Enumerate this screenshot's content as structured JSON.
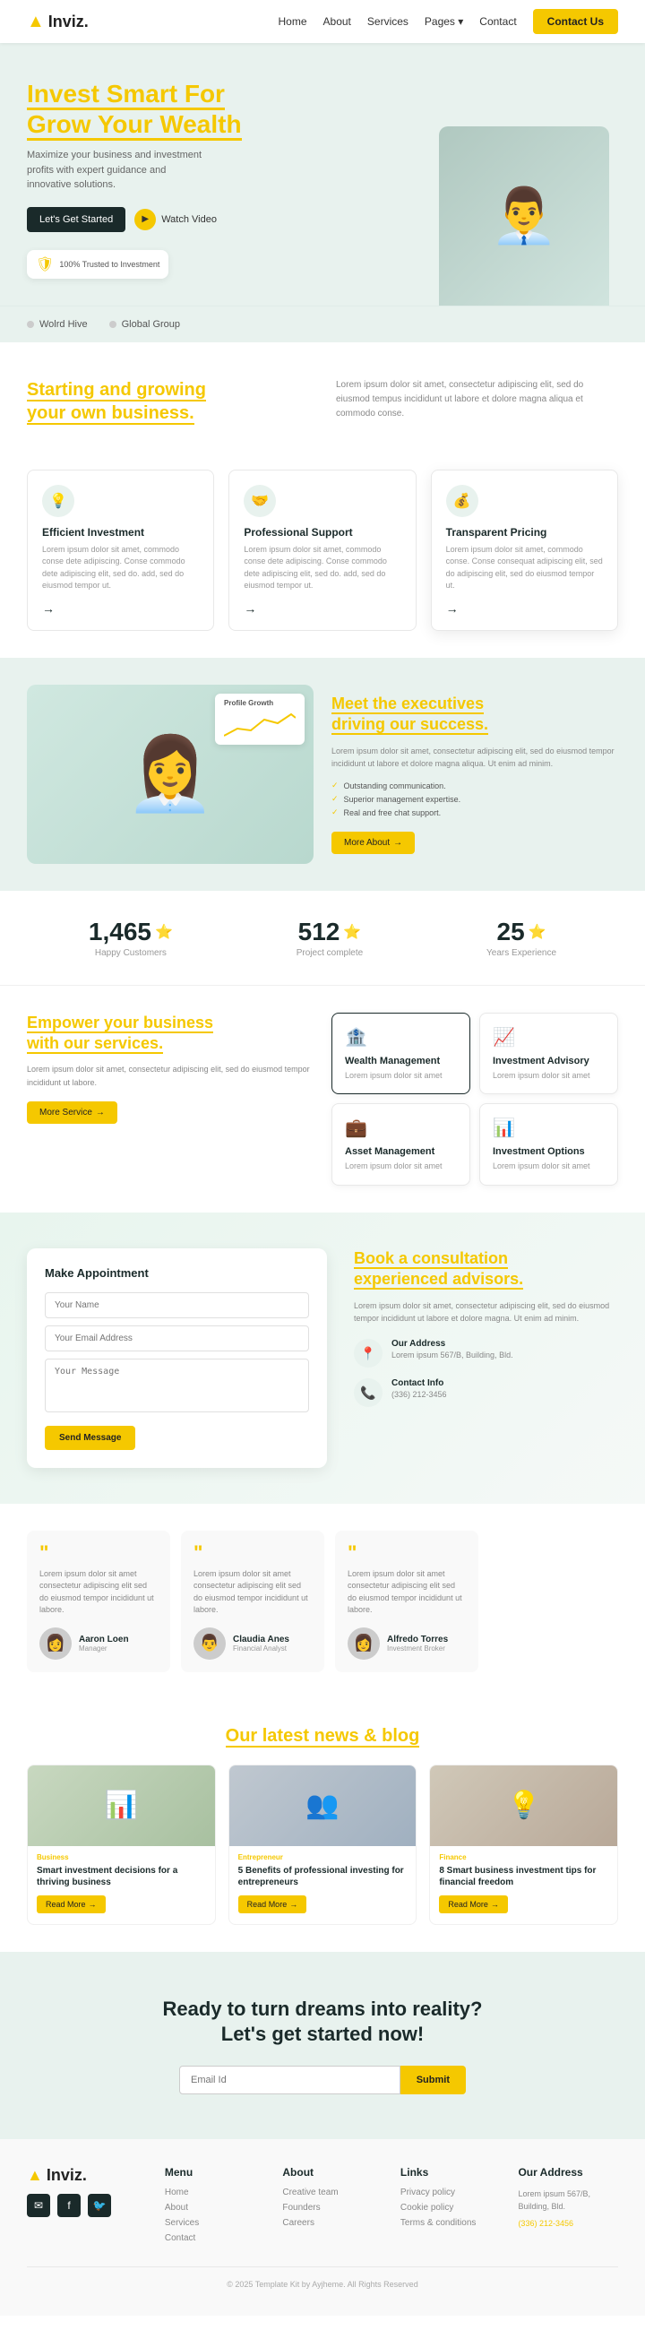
{
  "brand": {
    "logo": "Inviz.",
    "logo_icon": "▲"
  },
  "nav": {
    "links": [
      "Home",
      "About",
      "Services",
      "Pages ▾",
      "Contact"
    ],
    "cta": "Contact Us"
  },
  "hero": {
    "title_line1": "Invest Smart For",
    "title_line2": "Grow Your ",
    "title_highlight": "Wealth",
    "subtitle": "Maximize your business and investment profits with expert guidance and innovative solutions.",
    "btn_start": "Let's Get Started",
    "btn_watch": "Watch Video",
    "badge_text": "100% Trusted to Investment",
    "partner1": "Wolrd Hive",
    "partner2": "Global Group"
  },
  "section_start": {
    "heading_line1": "Starting and growing",
    "heading_line2": "your own ",
    "heading_highlight": "business.",
    "body": "Lorem ipsum dolor sit amet, consectetur adipiscing elit, sed do eiusmod tempus incididunt ut labore et dolore magna aliqua et commodo conse."
  },
  "features": [
    {
      "icon": "💡",
      "title": "Efficient Investment",
      "text": "Lorem ipsum dolor sit amet, commodo conse dete adipiscing. Conse commodo dete adipiscing elit, sed do. add, sed do eiusmod tempor ut.",
      "arrow": "→"
    },
    {
      "icon": "🤝",
      "title": "Professional Support",
      "text": "Lorem ipsum dolor sit amet, commodo conse dete adipiscing. Conse commodo dete adipiscing elit, sed do. add, sed do eiusmod tempor ut.",
      "arrow": "→"
    },
    {
      "icon": "💰",
      "title": "Transparent Pricing",
      "text": "Lorem ipsum dolor sit amet, commodo conse. Conse consequat adipiscing elit, sed do adipiscing elit, sed do eiusmod tempor ut.",
      "arrow": "→"
    }
  ],
  "executives": {
    "heading_pre": "Meet the executives",
    "heading_line2": "driving our ",
    "heading_highlight": "success.",
    "body": "Lorem ipsum dolor sit amet, consectetur adipiscing elit, sed do eiusmod tempor incididunt ut labore et dolore magna aliqua. Ut enim ad minim.",
    "checks": [
      "Outstanding communication.",
      "Superior management expertise.",
      "Real and free chat support."
    ],
    "btn": "More About",
    "profile_label": "Profile Growth"
  },
  "stats": [
    {
      "num": "1,465",
      "label": "Happy Customers"
    },
    {
      "num": "512",
      "label": "Project complete"
    },
    {
      "num": "25",
      "label": "Years Experience"
    }
  ],
  "services": {
    "heading_line1": "Empower your business",
    "heading_line2": "with our ",
    "heading_highlight": "services.",
    "body": "Lorem ipsum dolor sit amet, consectetur adipiscing elit, sed do eiusmod tempor incididunt ut labore.",
    "btn": "More Service",
    "items": [
      {
        "icon": "🏦",
        "title": "Wealth Management",
        "text": "Lorem ipsum dolor sit amet"
      },
      {
        "icon": "📈",
        "title": "Investment Advisory",
        "text": "Lorem ipsum dolor sit amet"
      },
      {
        "icon": "💼",
        "title": "Asset Management",
        "text": "Lorem ipsum dolor sit amet"
      },
      {
        "icon": "📊",
        "title": "Investment Options",
        "text": "Lorem ipsum dolor sit amet"
      }
    ]
  },
  "appointment": {
    "form_title": "Make Appointment",
    "name_placeholder": "Your Name",
    "email_placeholder": "Your Email Address",
    "message_placeholder": "Your Message",
    "btn_send": "Send Message",
    "heading_line1": "Book a consultation",
    "heading_line2": "experienced ",
    "heading_highlight": "advisors.",
    "body": "Lorem ipsum dolor sit amet, consectetur adipiscing elit, sed do eiusmod tempor incididunt ut labore et dolore magna. Ut enim ad minim.",
    "address_label": "Our Address",
    "address_val": "Lorem ipsum 567/B, Building, Bld.",
    "contact_label": "Contact Info",
    "contact_val": "(336) 212-3456"
  },
  "testimonials": [
    {
      "text": "Lorem ipsum dolor sit amet consectetur adipiscing elit sed do eiusmod tempor incididunt ut labore.",
      "name": "Aaron Loen",
      "role": "Manager"
    },
    {
      "text": "Lorem ipsum dolor sit amet consectetur adipiscing elit sed do eiusmod tempor incididunt ut labore.",
      "name": "Claudia Anes",
      "role": "Financial Analyst"
    },
    {
      "text": "Lorem ipsum dolor sit amet consectetur adipiscing elit sed do eiusmod tempor incididunt ut labore.",
      "name": "Alfredo Torres",
      "role": "Investment Broker"
    }
  ],
  "blog": {
    "heading": "Our latest news & ",
    "heading_highlight": "blog",
    "posts": [
      {
        "tag": "Business",
        "title": "Smart investment decisions for a thriving business",
        "btn": "Read More"
      },
      {
        "tag": "Entrepreneur",
        "title": "5 Benefits of professional investing for entrepreneurs",
        "btn": "Read More"
      },
      {
        "tag": "Finance",
        "title": "8 Smart business investment tips for financial freedom",
        "btn": "Read More"
      }
    ]
  },
  "cta": {
    "heading": "Ready to turn dreams into reality?\nLet's get started now!",
    "email_placeholder": "Email Id",
    "btn": "Submit"
  },
  "footer": {
    "logo": "Inviz.",
    "menu_title": "Menu",
    "menu_links": [
      "Home",
      "About",
      "Services",
      "Contact"
    ],
    "about_title": "About",
    "about_links": [
      "Creative team",
      "Founders",
      "Careers"
    ],
    "links_title": "Links",
    "links_links": [
      "Privacy policy",
      "Cookie policy",
      "Terms & conditions"
    ],
    "address_title": "Our Address",
    "address_text": "Lorem ipsum 567/B,\nBuilding, Bld.",
    "address_phone": "(336) 212-3456",
    "copyright": "© 2025 Template Kit by Ayjheme. All Rights Reserved",
    "social_icons": [
      "✉",
      "f",
      "🐦"
    ]
  }
}
